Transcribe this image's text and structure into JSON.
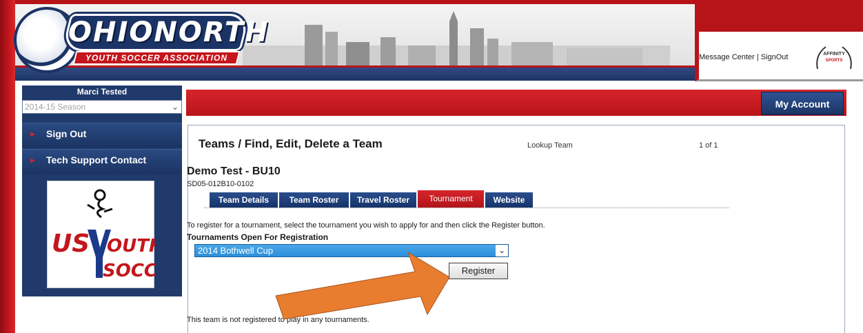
{
  "header": {
    "logo_word": "OHIONORTH",
    "logo_sub": "YOUTH SOCCER ASSOCIATION",
    "links": {
      "message_center": "Message Center",
      "separator": " | ",
      "sign_out": "SignOut"
    },
    "affinity_logo": "AFFINITY SPORTS"
  },
  "sidebar": {
    "user_name": "Marci Tested",
    "season": {
      "selected": "2014-15 Season",
      "icon": "chevron-down-icon"
    },
    "items": [
      {
        "label": "Sign Out"
      },
      {
        "label": "Tech Support Contact"
      }
    ],
    "usys_logo": "US YOUTH SOCCER"
  },
  "main": {
    "my_account": "My Account",
    "title": "Teams / Find, Edit, Delete a Team",
    "lookup": "Lookup Team",
    "count": "1 of 1",
    "team_name": "Demo Test - BU10",
    "team_code": "SD05-012B10-0102",
    "tabs": [
      {
        "label": "Team Details"
      },
      {
        "label": "Team Roster"
      },
      {
        "label": "Travel Roster"
      },
      {
        "label": "Tournament",
        "active": true
      },
      {
        "label": "Website"
      }
    ],
    "instructions": "To register for a tournament, select the tournament you wish to apply for and then click the Register button.",
    "open_label": "Tournaments Open For Registration",
    "tournament_selected": "2014 Bothwell Cup",
    "register_label": "Register",
    "not_registered": "This team is not registered to play in any tournaments."
  },
  "colors": {
    "brand_red": "#b7141a",
    "brand_navy": "#1f3a6b",
    "arrow": "#e87d2f",
    "select_blue": "#2b8fd9"
  }
}
